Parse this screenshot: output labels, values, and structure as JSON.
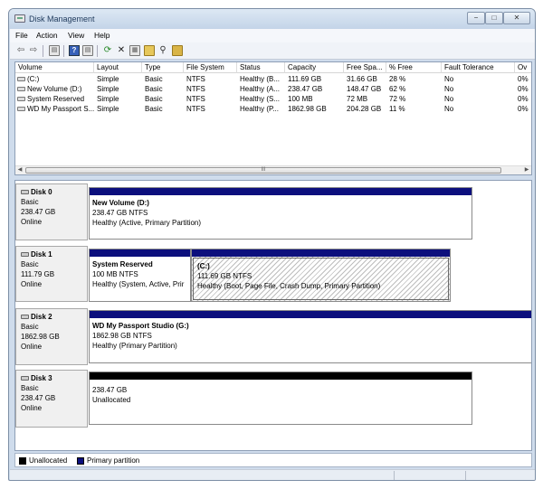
{
  "window": {
    "title": "Disk Management",
    "controls": {
      "minimize": "−",
      "maximize": "□",
      "close": "✕"
    }
  },
  "menu": [
    "File",
    "Action",
    "View",
    "Help"
  ],
  "toolbar": {
    "icons": [
      "back-arrow-icon",
      "forward-arrow-icon",
      "console-view-icon",
      "help-icon",
      "details-icon",
      "refresh-icon",
      "delete-icon",
      "properties-icon",
      "open-folder-icon",
      "search-icon",
      "check-disk-icon"
    ]
  },
  "volumes": {
    "columns": [
      "Volume",
      "Layout",
      "Type",
      "File System",
      "Status",
      "Capacity",
      "Free Spa...",
      "% Free",
      "Fault Tolerance",
      "Ov"
    ],
    "rows": [
      {
        "volume": "(C:)",
        "layout": "Simple",
        "type": "Basic",
        "fs": "NTFS",
        "status": "Healthy (B...",
        "capacity": "111.69 GB",
        "free": "31.66 GB",
        "pct": "28 %",
        "fault": "No",
        "ov": "0%"
      },
      {
        "volume": "New Volume (D:)",
        "layout": "Simple",
        "type": "Basic",
        "fs": "NTFS",
        "status": "Healthy (A...",
        "capacity": "238.47 GB",
        "free": "148.47 GB",
        "pct": "62 %",
        "fault": "No",
        "ov": "0%"
      },
      {
        "volume": "System Reserved",
        "layout": "Simple",
        "type": "Basic",
        "fs": "NTFS",
        "status": "Healthy (S...",
        "capacity": "100 MB",
        "free": "72 MB",
        "pct": "72 %",
        "fault": "No",
        "ov": "0%"
      },
      {
        "volume": "WD My Passport S...",
        "layout": "Simple",
        "type": "Basic",
        "fs": "NTFS",
        "status": "Healthy (P...",
        "capacity": "1862.98 GB",
        "free": "204.28 GB",
        "pct": "11 %",
        "fault": "No",
        "ov": "0%"
      }
    ],
    "scroll_grip": "III"
  },
  "disks": [
    {
      "name": "Disk 0",
      "type": "Basic",
      "size": "238.47 GB",
      "state": "Online",
      "partitions": [
        {
          "name": "New Volume  (D:)",
          "size": "238.47 GB NTFS",
          "status": "Healthy (Active, Primary Partition)"
        }
      ]
    },
    {
      "name": "Disk 1",
      "type": "Basic",
      "size": "111.79 GB",
      "state": "Online",
      "partitions": [
        {
          "name": "System Reserved",
          "size": "100 MB NTFS",
          "status": "Healthy (System, Active, Prir"
        },
        {
          "name": "(C:)",
          "size": "111.69 GB NTFS",
          "status": "Healthy (Boot, Page File, Crash Dump, Primary Partition)"
        }
      ]
    },
    {
      "name": "Disk 2",
      "type": "Basic",
      "size": "1862.98 GB",
      "state": "Online",
      "partitions": [
        {
          "name": "WD My Passport Studio  (G:)",
          "size": "1862.98 GB NTFS",
          "status": "Healthy (Primary Partition)"
        }
      ]
    },
    {
      "name": "Disk 3",
      "type": "Basic",
      "size": "238.47 GB",
      "state": "Online",
      "partitions": [
        {
          "size": "238.47 GB",
          "status": "Unallocated"
        }
      ]
    }
  ],
  "legend": [
    {
      "label": "Unallocated",
      "color": "#000000"
    },
    {
      "label": "Primary partition",
      "color": "#0c0f7d"
    }
  ]
}
